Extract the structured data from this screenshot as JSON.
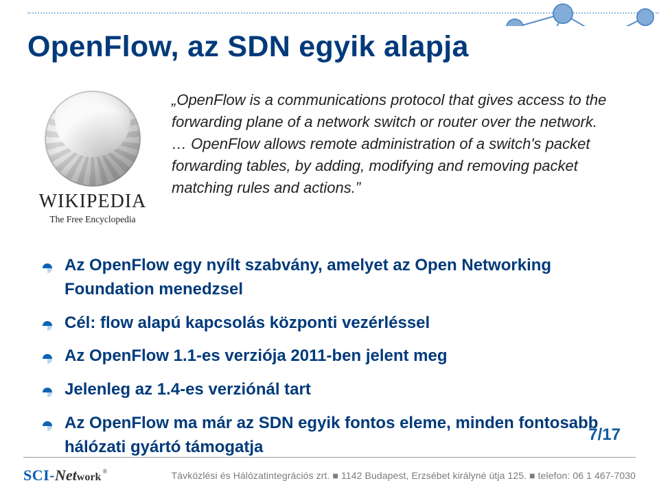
{
  "title": "OpenFlow, az SDN egyik alapja",
  "wikipedia": {
    "name": "WIKIPEDIA",
    "tagline": "The Free Encyclopedia"
  },
  "quote": {
    "open": "„",
    "p1": "OpenFlow is a communications protocol that gives access to the forwarding plane of a network switch or router over the network.",
    "ellipsis": "… ",
    "p2": "OpenFlow allows remote administration of a switch's packet forwarding tables, by adding, modifying and removing packet matching rules and actions.",
    "close": "”"
  },
  "bullets": [
    "Az OpenFlow egy nyílt szabvány, amelyet az Open Networking Foundation menedzsel",
    "Cél: flow alapú kapcsolás központi vezérléssel",
    "Az OpenFlow 1.1-es verziója 2011-ben jelent meg",
    "Jelenleg az 1.4-es verziónál tart",
    "Az OpenFlow ma már az SDN egyik fontos eleme, minden fontosabb hálózati gyártó támogatja"
  ],
  "page": {
    "current": "7",
    "sep": "/",
    "total": "17"
  },
  "footer": {
    "logo_sci": "SCI-",
    "logo_net": "Net",
    "logo_work": "work",
    "logo_reg": "®",
    "text": "Távközlési és Hálózatintegrációs zrt. ■ 1142 Budapest, Erzsébet királyné útja 125. ■ telefon: 06 1 467-7030"
  }
}
